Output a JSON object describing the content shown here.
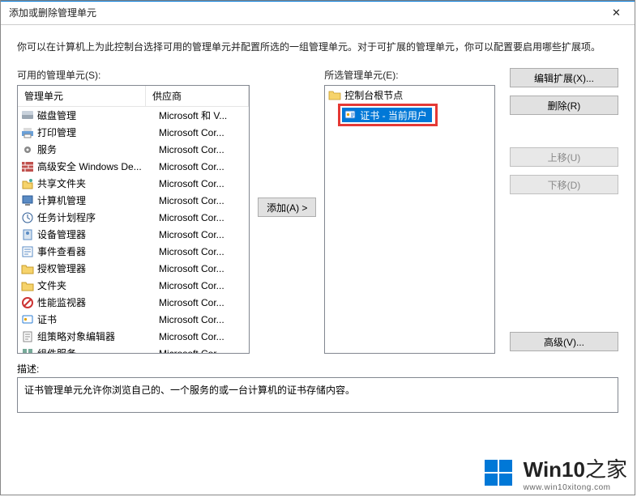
{
  "window": {
    "title": "添加或删除管理单元",
    "close_glyph": "✕"
  },
  "intro": "你可以在计算机上为此控制台选择可用的管理单元并配置所选的一组管理单元。对于可扩展的管理单元，你可以配置要启用哪些扩展项。",
  "labels": {
    "available": "可用的管理单元(S):",
    "selected": "所选管理单元(E):",
    "desc": "描述:"
  },
  "columns": {
    "c1": "管理单元",
    "c2": "供应商"
  },
  "snapins": [
    {
      "name": "磁盘管理",
      "vendor": "Microsoft 和 V...",
      "icon": "disk"
    },
    {
      "name": "打印管理",
      "vendor": "Microsoft Cor...",
      "icon": "print"
    },
    {
      "name": "服务",
      "vendor": "Microsoft Cor...",
      "icon": "gear"
    },
    {
      "name": "高级安全 Windows De...",
      "vendor": "Microsoft Cor...",
      "icon": "wall"
    },
    {
      "name": "共享文件夹",
      "vendor": "Microsoft Cor...",
      "icon": "share"
    },
    {
      "name": "计算机管理",
      "vendor": "Microsoft Cor...",
      "icon": "pc"
    },
    {
      "name": "任务计划程序",
      "vendor": "Microsoft Cor...",
      "icon": "clock"
    },
    {
      "name": "设备管理器",
      "vendor": "Microsoft Cor...",
      "icon": "device"
    },
    {
      "name": "事件查看器",
      "vendor": "Microsoft Cor...",
      "icon": "event"
    },
    {
      "name": "授权管理器",
      "vendor": "Microsoft Cor...",
      "icon": "folder"
    },
    {
      "name": "文件夹",
      "vendor": "Microsoft Cor...",
      "icon": "folder"
    },
    {
      "name": "性能监视器",
      "vendor": "Microsoft Cor...",
      "icon": "nope"
    },
    {
      "name": "证书",
      "vendor": "Microsoft Cor...",
      "icon": "cert"
    },
    {
      "name": "组策略对象编辑器",
      "vendor": "Microsoft Cor...",
      "icon": "policy"
    },
    {
      "name": "组件服务",
      "vendor": "Microsoft Cor...",
      "icon": "comp"
    }
  ],
  "tree": {
    "root": "控制台根节点",
    "child": "证书 - 当前用户"
  },
  "buttons": {
    "add": "添加(A) >",
    "edit_ext": "编辑扩展(X)...",
    "remove": "删除(R)",
    "up": "上移(U)",
    "down": "下移(D)",
    "adv": "高级(V)..."
  },
  "description": "证书管理单元允许你浏览自己的、一个服务的或一台计算机的证书存储内容。",
  "watermark": {
    "brand": "Win10",
    "sub": "之家",
    "url": "www.win10xitong.com"
  }
}
